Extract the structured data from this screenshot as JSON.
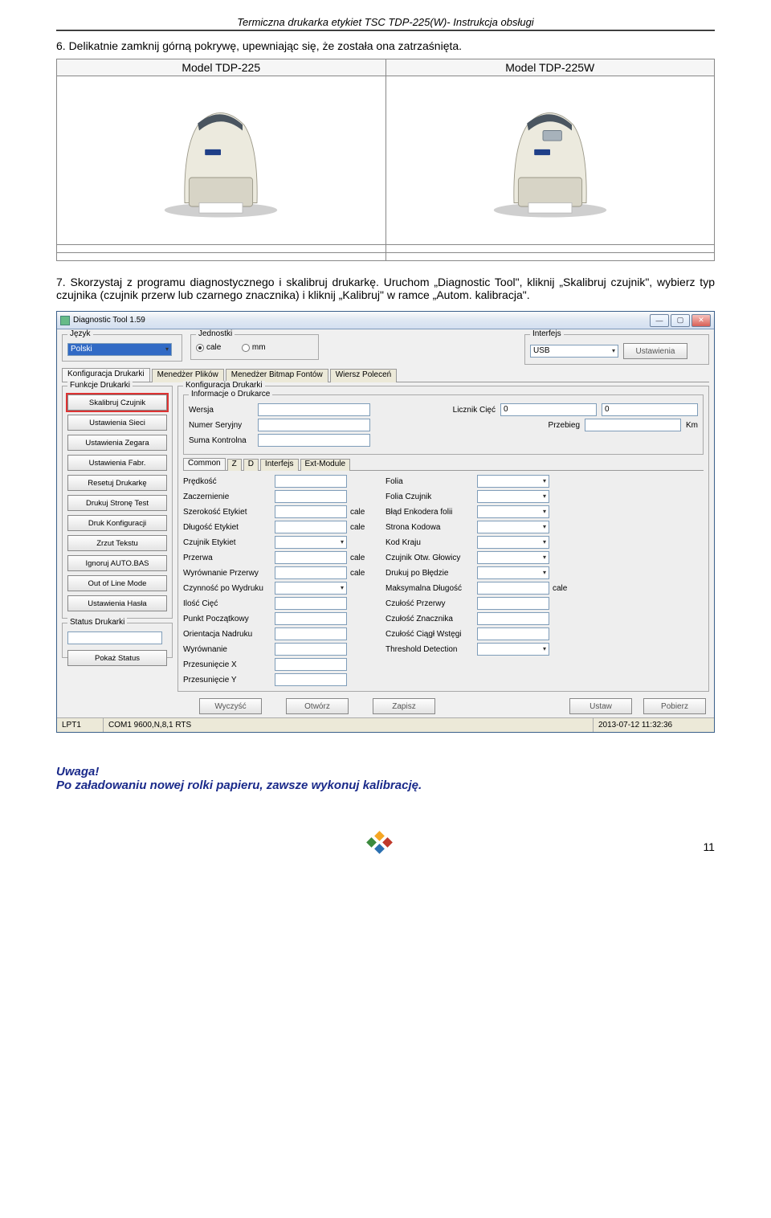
{
  "header": {
    "title": "Termiczna drukarka etykiet TSC TDP-225(W)- Instrukcja obsługi"
  },
  "step6": "6. Delikatnie zamknij górną pokrywę, upewniając się, że została ona zatrzaśnięta.",
  "printer_table": {
    "col1": "Model TDP-225",
    "col2": "Model TDP-225W"
  },
  "step7": "7. Skorzystaj z programu diagnostycznego i skalibruj drukarkę. Uruchom „Diagnostic Tool\", kliknij „Skalibruj czujnik\", wybierz typ czujnika (czujnik przerw lub czarnego znacznika) i kliknij „Kalibruj\" w ramce „Autom. kalibracja\".",
  "diag": {
    "title": "Diagnostic Tool 1.59",
    "groups": {
      "lang": "Język",
      "units": "Jednostki",
      "iface": "Interfejs",
      "funcs": "Funkcje Drukarki",
      "pconf": "Konfiguracja Drukarki",
      "pinfo": "Informacje o Drukarce",
      "status": "Status Drukarki"
    },
    "lang_value": "Polski",
    "units": {
      "opt1": "cale",
      "opt2": "mm"
    },
    "iface": {
      "value": "USB",
      "btn": "Ustawienia"
    },
    "tabs": [
      "Konfiguracja Drukarki",
      "Menedżer Plików",
      "Menedżer Bitmap Fontów",
      "Wiersz Poleceń"
    ],
    "func_btns": [
      "Skalibruj Czujnik",
      "Ustawienia Sieci",
      "Ustawienia Zegara",
      "Ustawienia Fabr.",
      "Resetuj Drukarkę",
      "Drukuj Stronę Test",
      "Druk Konfiguracji",
      "Zrzut Tekstu",
      "Ignoruj AUTO.BAS",
      "Out of Line Mode",
      "Ustawienia Hasła"
    ],
    "info": {
      "wersja": "Wersja",
      "numer": "Numer Seryjny",
      "suma": "Suma Kontrolna",
      "licznik": "Licznik Cięć",
      "licznik_v1": "0",
      "licznik_v2": "0",
      "przebieg": "Przebieg",
      "przebieg_unit": "Km"
    },
    "subtabs": [
      "Common",
      "Z",
      "D",
      "Interfejs",
      "Ext-Module"
    ],
    "settings": {
      "left": [
        {
          "l": "Prędkość",
          "u": ""
        },
        {
          "l": "Zaczernienie",
          "u": ""
        },
        {
          "l": "Szerokość Etykiet",
          "u": "cale"
        },
        {
          "l": "Długość Etykiet",
          "u": "cale"
        },
        {
          "l": "Czujnik Etykiet",
          "u": "",
          "combo": true
        },
        {
          "l": "Przerwa",
          "u": "cale"
        },
        {
          "l": "Wyrównanie Przerwy",
          "u": "cale"
        },
        {
          "l": "Czynność po Wydruku",
          "u": "",
          "combo": true
        },
        {
          "l": "Ilość Cięć",
          "u": ""
        },
        {
          "l": "Punkt Początkowy",
          "u": ""
        },
        {
          "l": "Orientacja Nadruku",
          "u": ""
        },
        {
          "l": "Wyrównanie",
          "u": ""
        },
        {
          "l": "Przesunięcie X",
          "u": ""
        },
        {
          "l": "Przesunięcie Y",
          "u": ""
        }
      ],
      "right": [
        {
          "l": "Folia",
          "combo": true
        },
        {
          "l": "Folia Czujnik",
          "combo": true
        },
        {
          "l": "Błąd Enkodera folii",
          "combo": true
        },
        {
          "l": "Strona Kodowa",
          "combo": true
        },
        {
          "l": "Kod Kraju",
          "combo": true
        },
        {
          "l": "Czujnik Otw. Głowicy",
          "combo": true
        },
        {
          "l": "Drukuj po Błędzie",
          "combo": true
        },
        {
          "l": "Maksymalna Długość",
          "u": "cale"
        },
        {
          "l": "Czułość Przerwy"
        },
        {
          "l": "Czułość Znacznika"
        },
        {
          "l": "Czułość Ciągł Wstęgi"
        },
        {
          "l": "Threshold Detection",
          "combo": true
        }
      ]
    },
    "status_btn": "Pokaż Status",
    "bottom_btns": [
      "Wyczyść",
      "Otwórz",
      "Zapisz",
      "Ustaw",
      "Pobierz"
    ],
    "statusbar": {
      "port": "LPT1",
      "cfg": "COM1 9600,N,8,1 RTS",
      "time": "2013-07-12 11:32:36"
    }
  },
  "uwaga": {
    "h": "Uwaga!",
    "t": "Po załadowaniu nowej rolki papieru, zawsze wykonuj kalibrację."
  },
  "page_num": "11"
}
